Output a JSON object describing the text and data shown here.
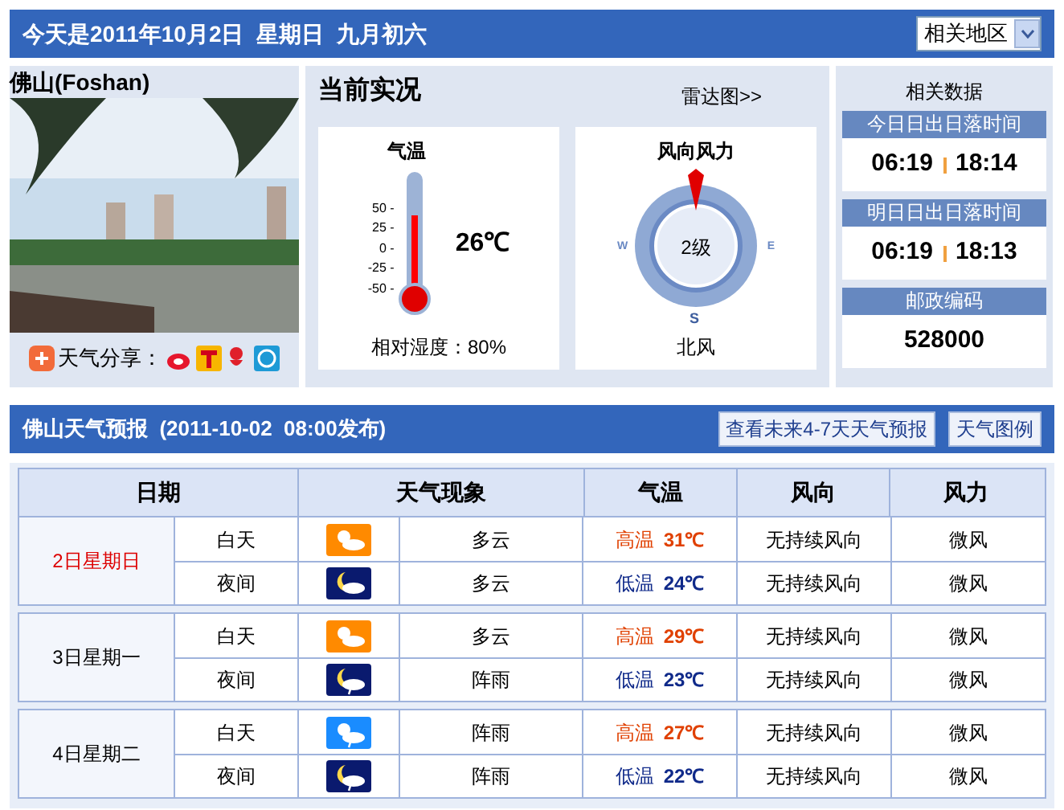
{
  "top_bar": {
    "title": "今天是2011年10月2日  星期日  九月初六",
    "region_select": "相关地区"
  },
  "city": {
    "name": "佛山(Foshan)",
    "share_label": "天气分享："
  },
  "current": {
    "title": "当前实况",
    "radar_link": "雷达图>>",
    "temperature": {
      "label": "气温",
      "ticks": [
        "50 -",
        "25 -",
        "0 -",
        "-25 -",
        "-50 -"
      ],
      "level": 0.62,
      "value": "26℃",
      "humidity_label": "相对湿度：",
      "humidity": "80%"
    },
    "wind": {
      "label": "风向风力",
      "compass": [
        "W",
        "E",
        "S"
      ],
      "force": "2级",
      "direction": "北风"
    }
  },
  "related": {
    "title": "相关数据",
    "blocks": [
      {
        "heading": "今日日出日落时间",
        "kind": "times",
        "values": [
          "06:19",
          "18:14"
        ]
      },
      {
        "heading": "明日日出日落时间",
        "kind": "times",
        "values": [
          "06:19",
          "18:13"
        ]
      },
      {
        "heading": "邮政编码",
        "kind": "single",
        "values": [
          "528000"
        ]
      }
    ]
  },
  "forecast": {
    "title": "佛山天气预报  (2011-10-02  08:00发布)",
    "buttons": [
      "查看未来4-7天天气预报",
      "天气图例"
    ],
    "columns": [
      "日期",
      "天气现象",
      "气温",
      "风向",
      "风力"
    ],
    "days": [
      {
        "date": "2日星期日",
        "today": true,
        "rows": [
          {
            "period": "白天",
            "icon": {
              "kind": "cloudy_day"
            },
            "weather": "多云",
            "temp": {
              "kind": "high",
              "label": "高温",
              "value": "31℃"
            },
            "wind_dir": "无持续风向",
            "wind_force": "微风"
          },
          {
            "period": "夜间",
            "icon": {
              "kind": "cloudy_night"
            },
            "weather": "多云",
            "temp": {
              "kind": "low",
              "label": "低温",
              "value": "24℃"
            },
            "wind_dir": "无持续风向",
            "wind_force": "微风"
          }
        ]
      },
      {
        "date": "3日星期一",
        "today": false,
        "rows": [
          {
            "period": "白天",
            "icon": {
              "kind": "cloudy_day"
            },
            "weather": "多云",
            "temp": {
              "kind": "high",
              "label": "高温",
              "value": "29℃"
            },
            "wind_dir": "无持续风向",
            "wind_force": "微风"
          },
          {
            "period": "夜间",
            "icon": {
              "kind": "shower_night"
            },
            "weather": "阵雨",
            "temp": {
              "kind": "low",
              "label": "低温",
              "value": "23℃"
            },
            "wind_dir": "无持续风向",
            "wind_force": "微风"
          }
        ]
      },
      {
        "date": "4日星期二",
        "today": false,
        "rows": [
          {
            "period": "白天",
            "icon": {
              "kind": "shower_day"
            },
            "weather": "阵雨",
            "temp": {
              "kind": "high",
              "label": "高温",
              "value": "27℃"
            },
            "wind_dir": "无持续风向",
            "wind_force": "微风"
          },
          {
            "period": "夜间",
            "icon": {
              "kind": "shower_night"
            },
            "weather": "阵雨",
            "temp": {
              "kind": "low",
              "label": "低温",
              "value": "22℃"
            },
            "wind_dir": "无持续风向",
            "wind_force": "微风"
          }
        ]
      }
    ]
  }
}
